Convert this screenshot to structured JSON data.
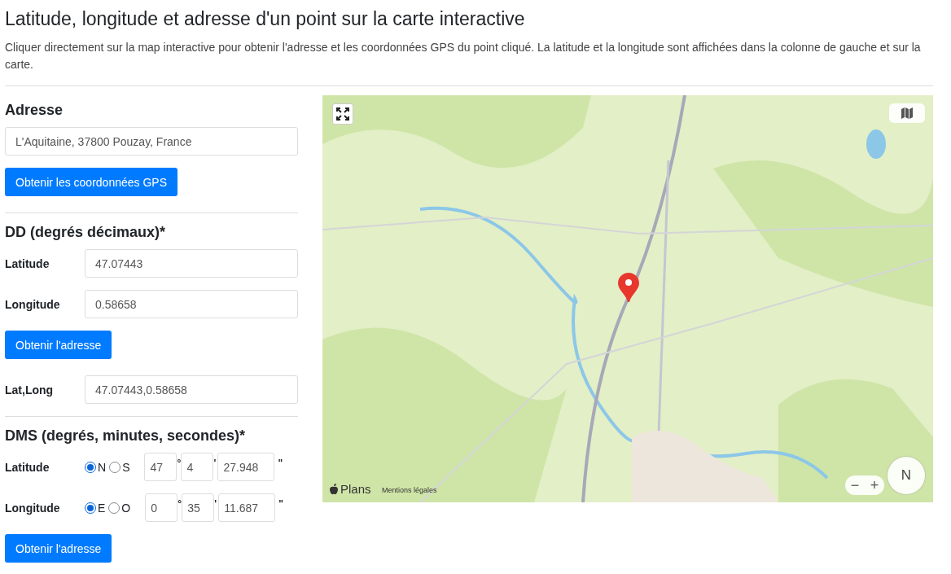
{
  "title": "Latitude, longitude et adresse d'un point sur la carte interactive",
  "description": "Cliquer directement sur la map interactive pour obtenir l'adresse et les coordonnées GPS du point cliqué. La latitude et la longitude sont affichées dans la colonne de gauche et sur la carte.",
  "address": {
    "heading": "Adresse",
    "value": "L'Aquitaine, 37800 Pouzay, France",
    "button": "Obtenir les coordonnées GPS"
  },
  "dd": {
    "heading": "DD (degrés décimaux)*",
    "fields": [
      {
        "label": "Latitude",
        "value": "47.07443"
      },
      {
        "label": "Longitude",
        "value": "0.58658"
      }
    ],
    "button": "Obtenir l'adresse",
    "latlong": {
      "label": "Lat,Long",
      "value": "47.07443,0.58658"
    }
  },
  "dms": {
    "heading": "DMS (degrés, minutes, secondes)*",
    "rows": [
      {
        "label": "Latitude",
        "options": [
          {
            "label": "N",
            "selected": true
          },
          {
            "label": "S",
            "selected": false
          }
        ],
        "degrees": "47",
        "minutes": "4",
        "seconds": "27.948",
        "marks": [
          "°",
          "'",
          "\""
        ]
      },
      {
        "label": "Longitude",
        "options": [
          {
            "label": "E",
            "selected": true
          },
          {
            "label": "O",
            "selected": false
          }
        ],
        "degrees": "0",
        "minutes": "35",
        "seconds": "11.687",
        "marks": [
          "°",
          "'",
          "\""
        ]
      }
    ],
    "button": "Obtenir l'adresse"
  },
  "map": {
    "kind": "picture",
    "logo": "Plans",
    "legal": "Mentions légales",
    "zoom_out": "−",
    "zoom_in": "+",
    "compass": "N"
  }
}
